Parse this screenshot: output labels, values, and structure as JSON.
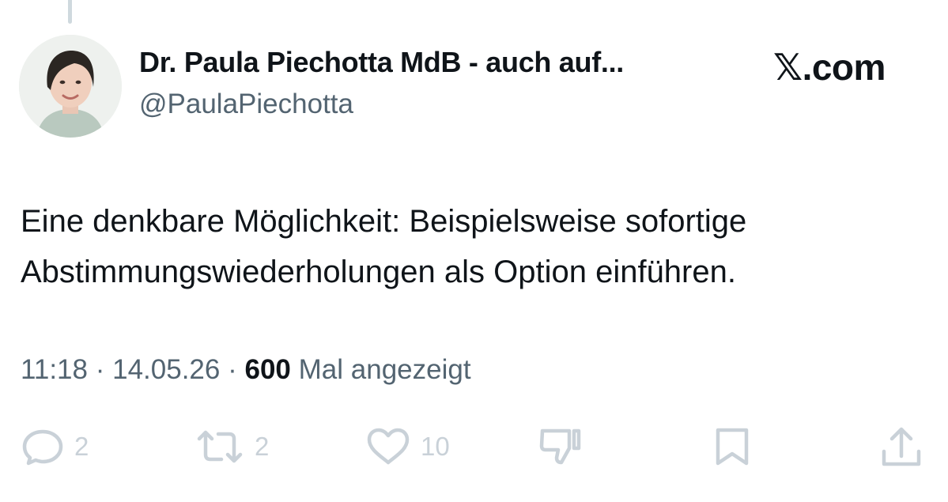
{
  "tweet": {
    "author": {
      "name": "Dr. Paula Piechotta MdB - auch auf...",
      "handle": "@PaulaPiechotta"
    },
    "source_logo": {
      "glyph": "𝕏",
      "domain": ".com"
    },
    "text_lines": [
      "Eine denkbare Möglichkeit: Beispielsweise sofortige",
      "Abstimmungswiederholungen als Option einführen."
    ],
    "time": "11:18",
    "date": "14.05.26",
    "separator": "·",
    "views_count": "600",
    "views_label": "Mal angezeigt",
    "actions": {
      "replies": {
        "icon": "reply-icon",
        "count": "2"
      },
      "reposts": {
        "icon": "repost-icon",
        "count": "2"
      },
      "likes": {
        "icon": "heart-icon",
        "count": "10"
      },
      "downvote": {
        "icon": "thumbs-down-icon"
      },
      "bookmark": {
        "icon": "bookmark-icon"
      },
      "share": {
        "icon": "share-icon"
      }
    }
  },
  "colors": {
    "text_primary": "#0f1419",
    "text_secondary": "#536471",
    "action_icon": "#c9d1d8",
    "thread_line": "#cfd9de"
  }
}
